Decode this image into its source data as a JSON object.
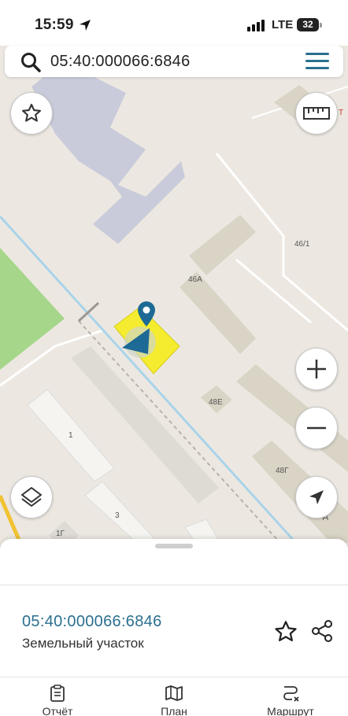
{
  "status_bar": {
    "time": "15:59",
    "network": "LTE",
    "battery": "32"
  },
  "search": {
    "value": "05:40:000066:6846",
    "placeholder": ""
  },
  "map": {
    "building_labels": [
      "46/1",
      "46А",
      "48Е",
      "48Г",
      "1",
      "3",
      "1Г",
      "Д",
      "Т"
    ],
    "parcel_color": "#f5ec2f",
    "marker_color": "#1e6a96",
    "park_color": "#a6d68a",
    "canal_color": "#a9d3ea"
  },
  "map_controls": [
    "favorite-icon",
    "ruler-icon",
    "layers-icon",
    "zoom-in-icon",
    "zoom-out-icon",
    "navigation-icon"
  ],
  "sheet": {
    "cadastral_number": "05:40:000066:6846",
    "object_type": "Земельный участок"
  },
  "tabs": [
    {
      "label": "Отчёт",
      "icon": "report-icon"
    },
    {
      "label": "План",
      "icon": "map-plan-icon"
    },
    {
      "label": "Маршрут",
      "icon": "route-icon"
    }
  ],
  "colors": {
    "accent": "#2a6f8f",
    "map_background": "#ece8e1",
    "building": "#d9d4c5"
  }
}
